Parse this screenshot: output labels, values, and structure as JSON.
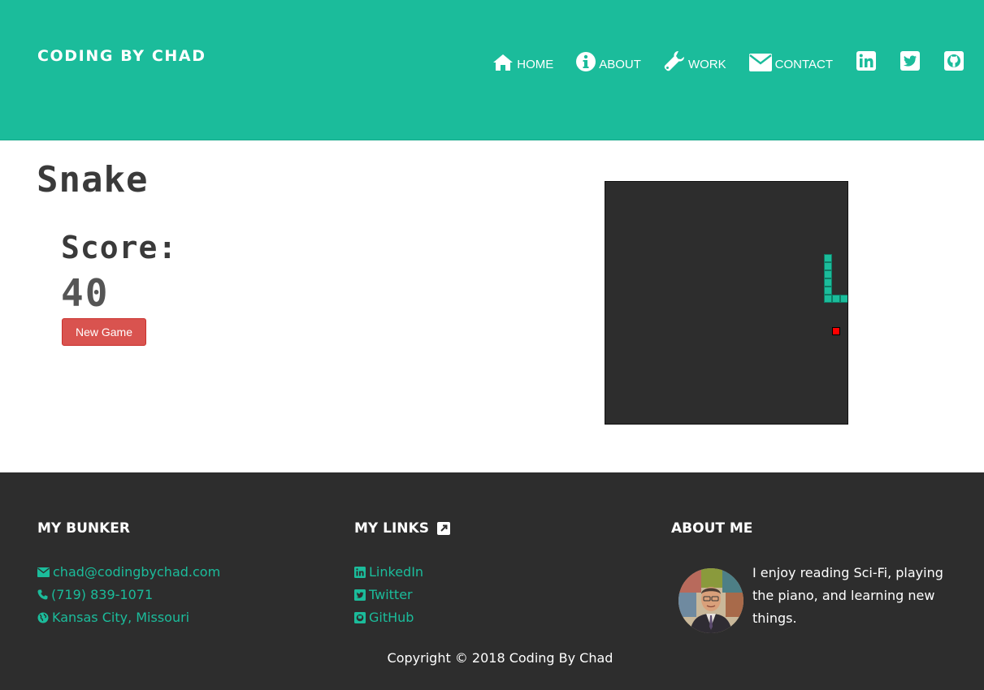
{
  "header": {
    "brand": "CODING BY CHAD",
    "nav": [
      {
        "label": "HOME",
        "icon": "home-icon"
      },
      {
        "label": "ABOUT",
        "icon": "info-icon"
      },
      {
        "label": "WORK",
        "icon": "wrench-icon"
      },
      {
        "label": "CONTACT",
        "icon": "envelope-icon"
      }
    ],
    "social": [
      "linkedin-icon",
      "twitter-icon",
      "github-icon"
    ],
    "color": "#1bbc9b"
  },
  "game": {
    "title": "Snake",
    "score_label": "Score:",
    "score_value": "40",
    "new_game_label": "New Game",
    "board_bg": "#2d2d2d",
    "snake_color": "#1bbc9b",
    "food_color": "#ff0000"
  },
  "footer": {
    "bunker_title": "MY BUNKER",
    "email": "chad@codingbychad.com",
    "phone": "(719) 839-1071",
    "location": "Kansas City, Missouri",
    "links_title": "MY LINKS",
    "links": [
      "LinkedIn",
      "Twitter",
      "GitHub"
    ],
    "about_title": "ABOUT ME",
    "about_text": "I enjoy reading Sci-Fi, playing the piano, and learning new things.",
    "copyright": "Copyright © 2018 Coding By Chad"
  }
}
